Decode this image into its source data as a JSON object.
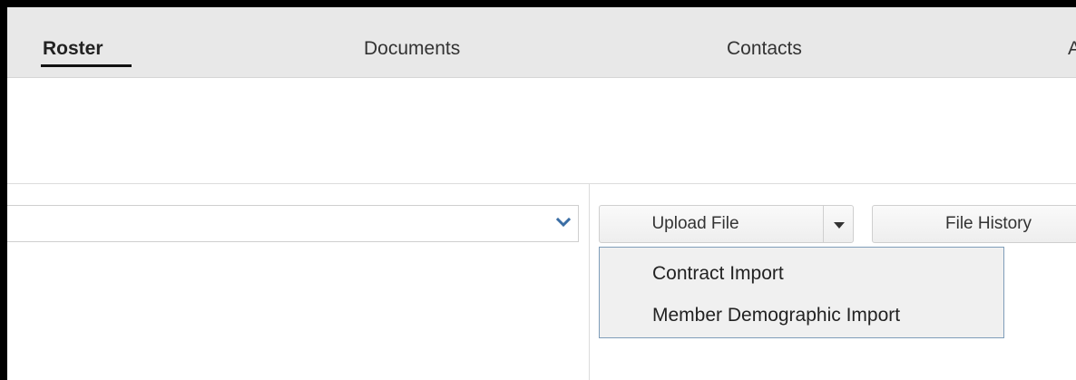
{
  "tabs": {
    "roster": "Roster",
    "documents": "Documents",
    "contacts": "Contacts",
    "partial": "A"
  },
  "toolbar": {
    "upload_label": "Upload File",
    "history_label": "File History"
  },
  "upload_menu": {
    "items": [
      "Contract Import",
      "Member Demographic Import"
    ]
  },
  "colors": {
    "tab_bar": "#e8e8e8",
    "menu_bg": "#f0f0f0",
    "menu_border": "#7f9db9",
    "select_caret": "#3b6ea5"
  },
  "icons": {
    "select_caret": "chevron-down-icon",
    "upload_caret": "caret-down-icon"
  }
}
